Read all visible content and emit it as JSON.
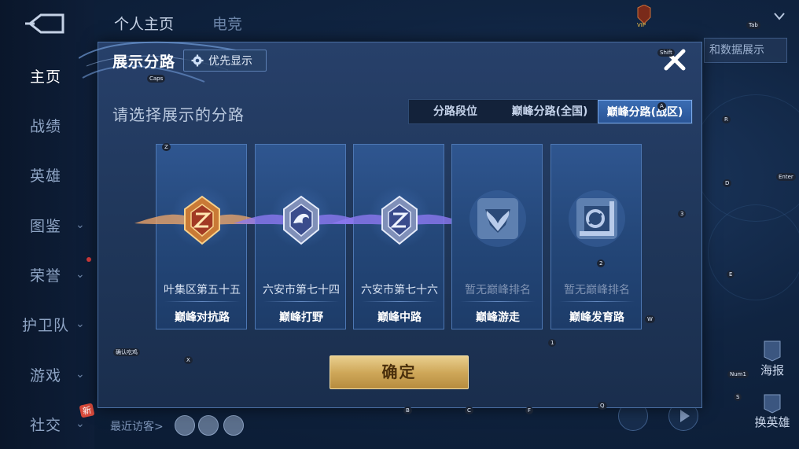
{
  "background": {
    "top_tabs": [
      "个人主页",
      "电竞"
    ],
    "right_button_label": "和数据展示",
    "recent_visitors_label": "最近访客>",
    "poster_label": "海报",
    "swap_hero_label": "换英雄",
    "profile_badge": "VIP"
  },
  "sidebar": {
    "items": [
      {
        "label": "主页",
        "active": true
      },
      {
        "label": "战绩"
      },
      {
        "label": "英雄"
      },
      {
        "label": "图鉴",
        "chevron": "⌄"
      },
      {
        "label": "荣誉",
        "chevron": "⌄"
      },
      {
        "label": "护卫队",
        "chevron": "⌄"
      },
      {
        "label": "游戏",
        "chevron": "⌄"
      },
      {
        "label": "社交",
        "chevron": "⌄"
      }
    ],
    "new_badge": "新"
  },
  "dialog": {
    "title": "展示分路",
    "priority_label": "优先显示",
    "subtitle": "请选择展示的分路",
    "tabs": [
      {
        "label": "分路段位"
      },
      {
        "label": "巅峰分路(全国)"
      },
      {
        "label": "巅峰分路(战区)",
        "active": true
      }
    ],
    "cards": [
      {
        "rank": "叶集区第五十五",
        "role": "巅峰对抗路",
        "emblem": "gold-shield-emblem"
      },
      {
        "rank": "六安市第七十四",
        "role": "巅峰打野",
        "emblem": "silver-dragon-emblem"
      },
      {
        "rank": "六安市第七十六",
        "role": "巅峰中路",
        "emblem": "silver-shield-emblem"
      },
      {
        "rank": "暂无巅峰排名",
        "role": "巅峰游走",
        "emblem": "wings-icon",
        "dim": true
      },
      {
        "rank": "暂无巅峰排名",
        "role": "巅峰发育路",
        "emblem": "target-icon",
        "dim": true
      }
    ],
    "confirm_label": "确定"
  },
  "key_hints": [
    "Caps",
    "Z",
    "X",
    "B",
    "C",
    "F",
    "Q",
    "1",
    "2",
    "3",
    "W",
    "E",
    "D",
    "R",
    "A",
    "S",
    "Shift",
    "Tab",
    "Enter",
    "Num1",
    "确认吃鸡"
  ],
  "colors": {
    "accent_blue": "#3a6cb3",
    "confirm_gold": "#cfa85a",
    "dialog_bg": "#27406a"
  }
}
